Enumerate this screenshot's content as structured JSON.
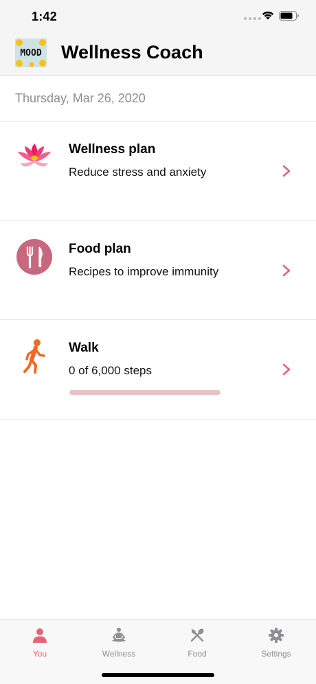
{
  "status_bar": {
    "time": "1:42"
  },
  "header": {
    "title": "Wellness Coach",
    "logo_text": "MOOD",
    "logo_icon": "mood-logo-icon"
  },
  "date": "Thursday, Mar 26, 2020",
  "cards": [
    {
      "title": "Wellness plan",
      "subtitle": "Reduce stress and anxiety",
      "icon": "lotus-icon"
    },
    {
      "title": "Food plan",
      "subtitle": "Recipes to improve immunity",
      "icon": "fork-knife-icon"
    },
    {
      "title": "Walk",
      "subtitle": "0 of 6,000 steps",
      "icon": "walking-person-icon",
      "progress": 0
    }
  ],
  "tabs": [
    {
      "label": "You",
      "icon": "person-icon",
      "active": true
    },
    {
      "label": "Wellness",
      "icon": "meditation-icon",
      "active": false
    },
    {
      "label": "Food",
      "icon": "utensils-icon",
      "active": false
    },
    {
      "label": "Settings",
      "icon": "gear-icon",
      "active": false
    }
  ],
  "colors": {
    "accent": "#e06676",
    "progress_track": "#ecc1c6",
    "food_icon_bg": "#c8687e",
    "walk_icon": "#f06a23"
  }
}
